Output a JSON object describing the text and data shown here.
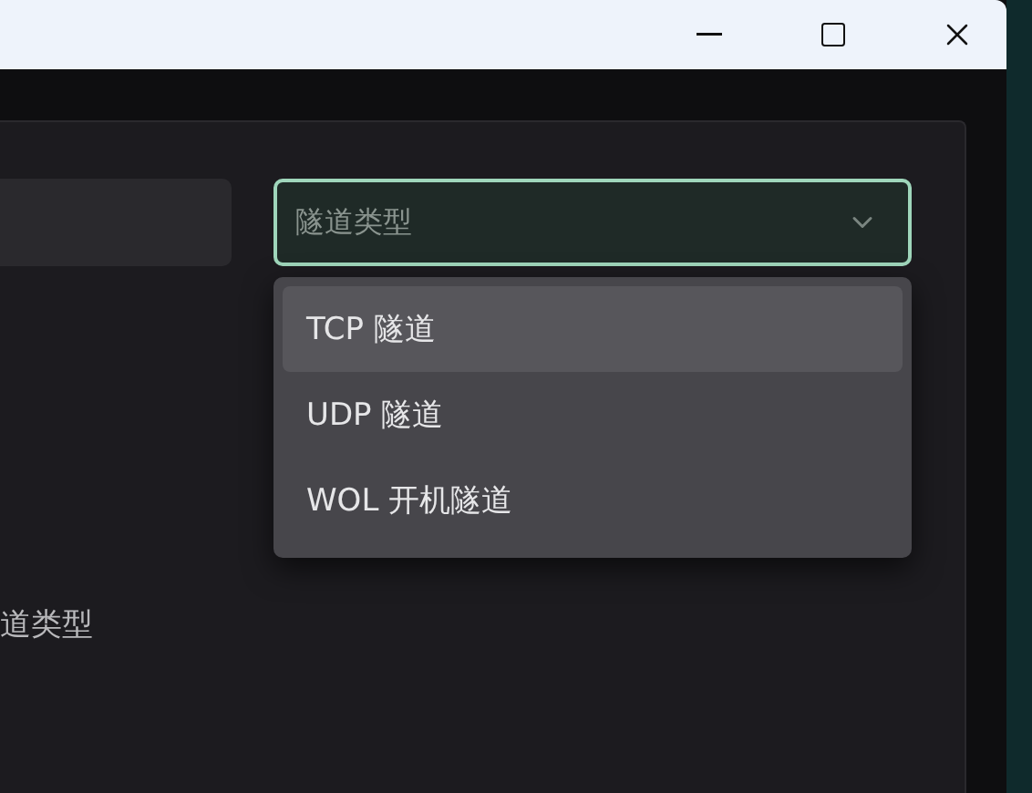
{
  "window": {
    "controls": [
      {
        "kind": "minimize"
      },
      {
        "kind": "maximize"
      },
      {
        "kind": "close"
      }
    ]
  },
  "form": {
    "select": {
      "placeholder": "隧道类型",
      "expanded": true
    },
    "options": [
      {
        "label": "TCP 隧道",
        "selected": true
      },
      {
        "label": "UDP 隧道",
        "selected": false
      },
      {
        "label": "WOL 开机隧道",
        "selected": false
      }
    ],
    "label": "道类型"
  }
}
